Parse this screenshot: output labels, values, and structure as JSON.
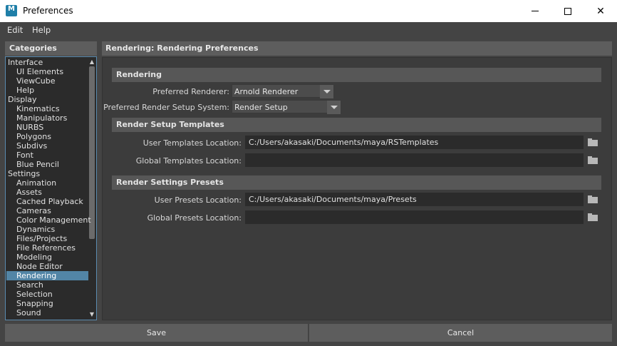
{
  "window": {
    "title": "Preferences",
    "icon_letter": "M"
  },
  "menu": [
    "Edit",
    "Help"
  ],
  "categories": {
    "header": "Categories",
    "items": [
      {
        "label": "Interface",
        "level": "top"
      },
      {
        "label": "UI Elements",
        "level": "sub"
      },
      {
        "label": "ViewCube",
        "level": "sub"
      },
      {
        "label": "Help",
        "level": "sub"
      },
      {
        "label": "Display",
        "level": "top"
      },
      {
        "label": "Kinematics",
        "level": "sub"
      },
      {
        "label": "Manipulators",
        "level": "sub"
      },
      {
        "label": "NURBS",
        "level": "sub"
      },
      {
        "label": "Polygons",
        "level": "sub"
      },
      {
        "label": "Subdivs",
        "level": "sub"
      },
      {
        "label": "Font",
        "level": "sub"
      },
      {
        "label": "Blue Pencil",
        "level": "sub"
      },
      {
        "label": "Settings",
        "level": "top"
      },
      {
        "label": "Animation",
        "level": "sub"
      },
      {
        "label": "Assets",
        "level": "sub"
      },
      {
        "label": "Cached Playback",
        "level": "sub"
      },
      {
        "label": "Cameras",
        "level": "sub"
      },
      {
        "label": "Color Management",
        "level": "sub"
      },
      {
        "label": "Dynamics",
        "level": "sub"
      },
      {
        "label": "Files/Projects",
        "level": "sub"
      },
      {
        "label": "File References",
        "level": "sub"
      },
      {
        "label": "Modeling",
        "level": "sub"
      },
      {
        "label": "Node Editor",
        "level": "sub"
      },
      {
        "label": "Rendering",
        "level": "sub",
        "selected": true
      },
      {
        "label": "Search",
        "level": "sub"
      },
      {
        "label": "Selection",
        "level": "sub"
      },
      {
        "label": "Snapping",
        "level": "sub"
      },
      {
        "label": "Sound",
        "level": "sub"
      }
    ]
  },
  "main": {
    "header": "Rendering: Rendering Preferences",
    "rendering": {
      "title": "Rendering",
      "preferred_renderer_label": "Preferred Renderer:",
      "preferred_renderer_value": "Arnold Renderer",
      "render_setup_label": "Preferred Render Setup System:",
      "render_setup_value": "Render Setup"
    },
    "templates": {
      "title": "Render Setup Templates",
      "user_label": "User Templates Location:",
      "user_value": "C:/Users/akasaki/Documents/maya/RSTemplates",
      "global_label": "Global Templates Location:",
      "global_value": ""
    },
    "presets": {
      "title": "Render Settings Presets",
      "user_label": "User Presets Location:",
      "user_value": "C:/Users/akasaki/Documents/maya/Presets",
      "global_label": "Global Presets Location:",
      "global_value": ""
    }
  },
  "buttons": {
    "save": "Save",
    "cancel": "Cancel"
  }
}
